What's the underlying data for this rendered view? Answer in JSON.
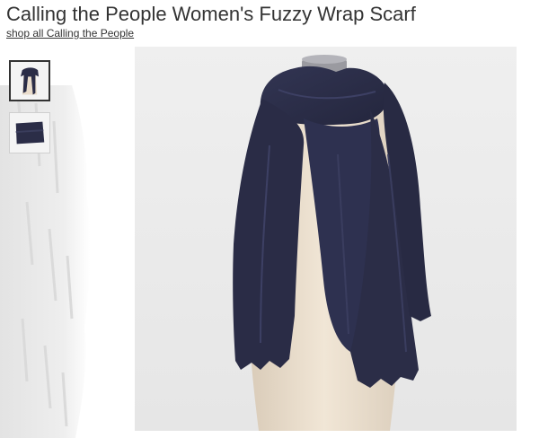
{
  "product": {
    "title": "Calling the People Women's Fuzzy Wrap Scarf",
    "brand_link": "shop all Calling the People"
  },
  "gallery": {
    "thumbnails": [
      {
        "view": "mannequin",
        "selected": true
      },
      {
        "view": "folded",
        "selected": false
      }
    ]
  },
  "colors": {
    "scarf": "#2b2d47",
    "background": "#ececec",
    "text": "#333333"
  }
}
